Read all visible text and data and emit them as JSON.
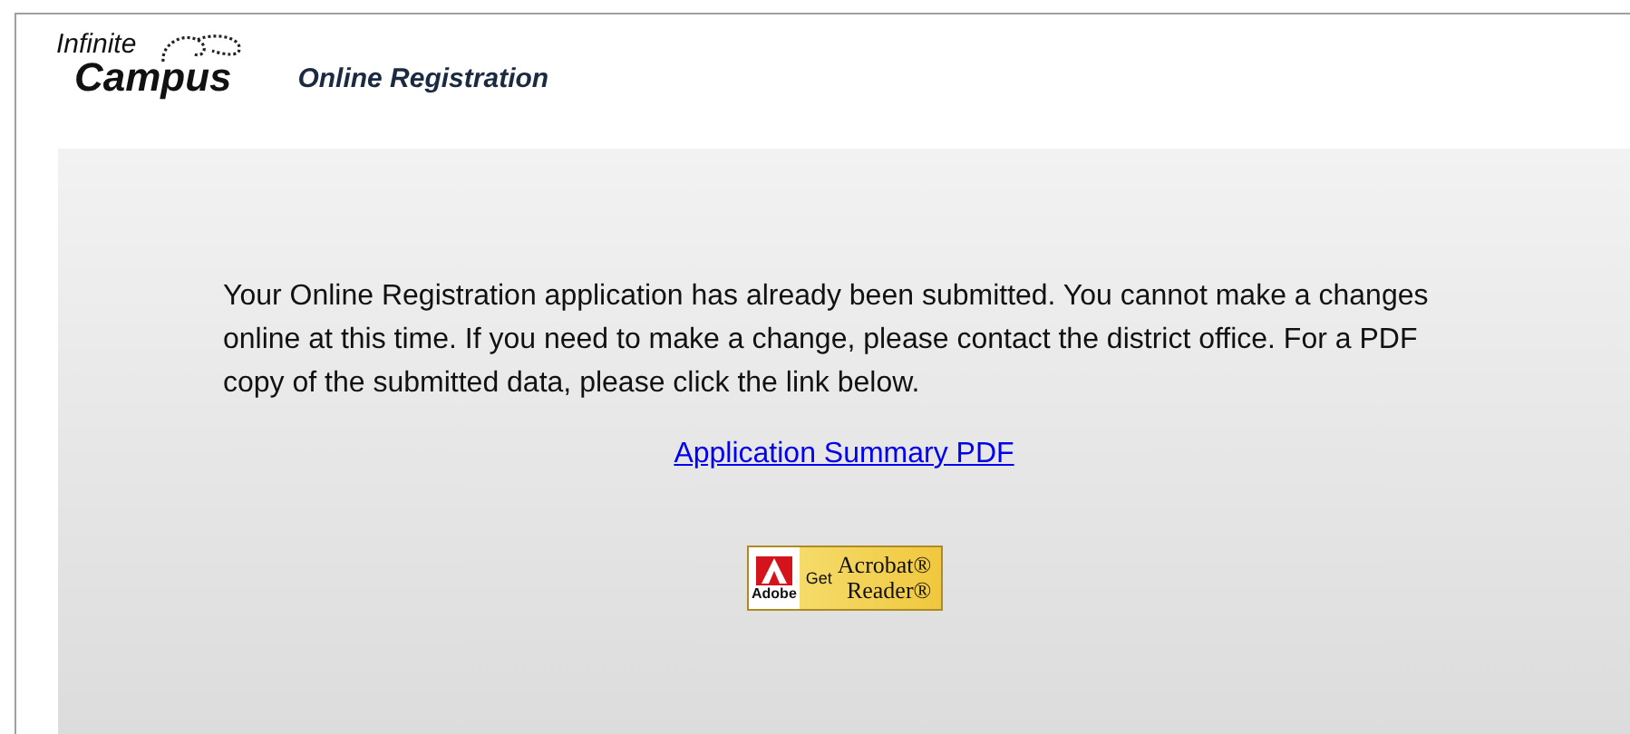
{
  "header": {
    "logo_line_1": "Infinite",
    "logo_line_2": "Campus",
    "title": "Online Registration"
  },
  "message": "Your Online Registration application has already been submitted. You cannot make a changes online at this time. If you need to make a change, please contact the district office. For a PDF copy of the submitted data, please click the link below.",
  "link": "Application Summary PDF",
  "badge": {
    "brand": "Adobe",
    "get": "Get",
    "line_1": "Acrobat®",
    "line_2": "Reader®"
  }
}
